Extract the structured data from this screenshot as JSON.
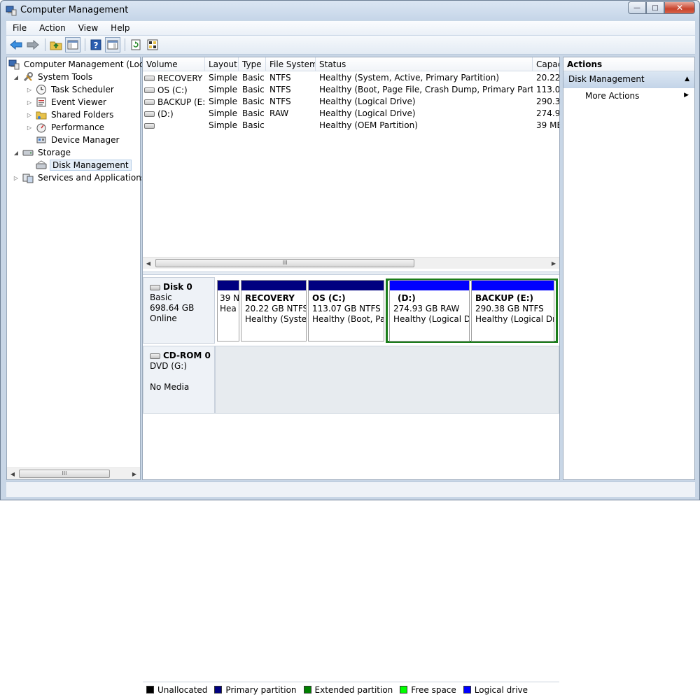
{
  "window": {
    "title": "Computer Management",
    "controls": {
      "minimize": "—",
      "maximize": "□",
      "close": "✕"
    }
  },
  "menu": [
    "File",
    "Action",
    "View",
    "Help"
  ],
  "tree": {
    "root": "Computer Management (Local",
    "items": [
      {
        "label": "System Tools",
        "level": 1,
        "expander": "◢",
        "icon": "tools-icon"
      },
      {
        "label": "Task Scheduler",
        "level": 2,
        "expander": "▷",
        "icon": "clock-icon"
      },
      {
        "label": "Event Viewer",
        "level": 2,
        "expander": "▷",
        "icon": "event-viewer-icon"
      },
      {
        "label": "Shared Folders",
        "level": 2,
        "expander": "▷",
        "icon": "shared-folder-icon"
      },
      {
        "label": "Performance",
        "level": 2,
        "expander": "▷",
        "icon": "performance-icon"
      },
      {
        "label": "Device Manager",
        "level": 2,
        "expander": "",
        "icon": "device-manager-icon"
      },
      {
        "label": "Storage",
        "level": 1,
        "expander": "◢",
        "icon": "storage-icon"
      },
      {
        "label": "Disk Management",
        "level": 2,
        "expander": "",
        "icon": "disk-management-icon",
        "selected": true
      },
      {
        "label": "Services and Applications",
        "level": 1,
        "expander": "▷",
        "icon": "services-icon"
      }
    ]
  },
  "volumes": {
    "columns": [
      "Volume",
      "Layout",
      "Type",
      "File System",
      "Status",
      "Capac"
    ],
    "rows": [
      {
        "volume": "RECOVERY",
        "layout": "Simple",
        "type": "Basic",
        "fs": "NTFS",
        "status": "Healthy (System, Active, Primary Partition)",
        "capacity": "20.22 ("
      },
      {
        "volume": "OS (C:)",
        "layout": "Simple",
        "type": "Basic",
        "fs": "NTFS",
        "status": "Healthy (Boot, Page File, Crash Dump, Primary Partition)",
        "capacity": "113.07"
      },
      {
        "volume": "BACKUP (E:)",
        "layout": "Simple",
        "type": "Basic",
        "fs": "NTFS",
        "status": "Healthy (Logical Drive)",
        "capacity": "290.38"
      },
      {
        "volume": "(D:)",
        "layout": "Simple",
        "type": "Basic",
        "fs": "RAW",
        "status": "Healthy (Logical Drive)",
        "capacity": "274.93"
      },
      {
        "volume": "",
        "layout": "Simple",
        "type": "Basic",
        "fs": "",
        "status": "Healthy (OEM Partition)",
        "capacity": "39 MB"
      }
    ],
    "scroll_thumb": "III"
  },
  "disks": {
    "disk0": {
      "name": "Disk 0",
      "type": "Basic",
      "size": "698.64 GB",
      "state": "Online",
      "partitions": [
        {
          "name": "",
          "size": "39 N",
          "status": "Hea"
        },
        {
          "name": "RECOVERY",
          "size": "20.22 GB NTFS",
          "status": "Healthy (Syster"
        },
        {
          "name": "OS  (C:)",
          "size": "113.07 GB NTFS",
          "status": "Healthy (Boot, Pag"
        },
        {
          "name": "(D:)",
          "size": "274.93 GB RAW",
          "status": "Healthy (Logical Dr"
        },
        {
          "name": "BACKUP  (E:)",
          "size": "290.38 GB NTFS",
          "status": "Healthy (Logical Dri"
        }
      ]
    },
    "cdrom0": {
      "name": "CD-ROM 0",
      "type": "DVD (G:)",
      "state": "No Media"
    }
  },
  "legend": [
    {
      "label": "Unallocated",
      "color": "#000000"
    },
    {
      "label": "Primary partition",
      "color": "#000080"
    },
    {
      "label": "Extended partition",
      "color": "#008000"
    },
    {
      "label": "Free space",
      "color": "#00ff00"
    },
    {
      "label": "Logical drive",
      "color": "#0000ff"
    }
  ],
  "actions": {
    "title": "Actions",
    "section": "Disk Management",
    "items": [
      "More Actions"
    ]
  },
  "colors": {
    "primary_bar": "#000080",
    "logical_bar": "#0000ff",
    "extended_frame": "#1b7d1b"
  }
}
